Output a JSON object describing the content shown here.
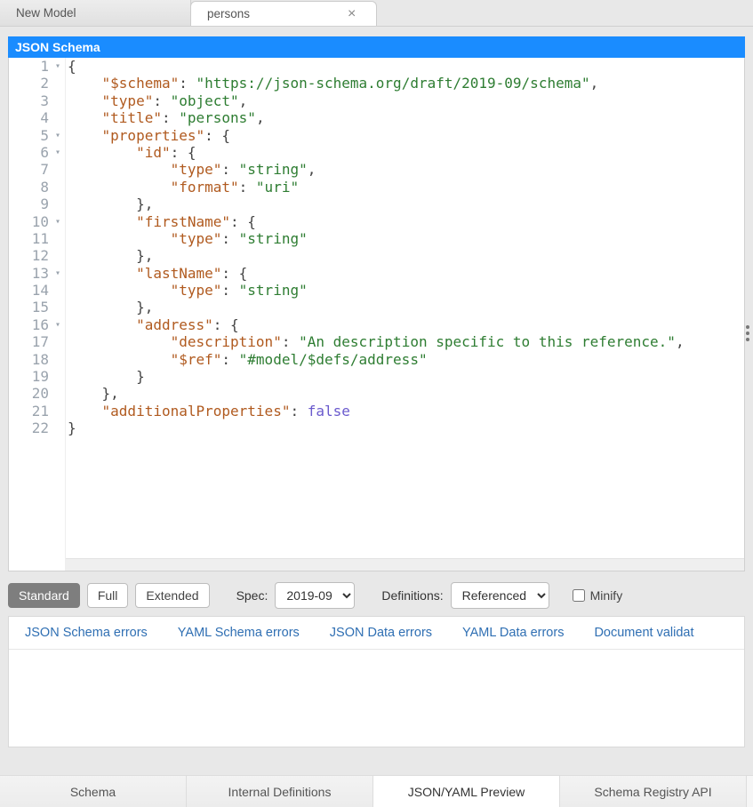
{
  "topTabs": [
    {
      "label": "New Model",
      "active": false
    },
    {
      "label": "persons",
      "active": true
    }
  ],
  "editorHeader": "JSON Schema",
  "code": {
    "lines": [
      {
        "n": 1,
        "fold": true,
        "segs": [
          {
            "t": "{",
            "c": "p"
          }
        ]
      },
      {
        "n": 2,
        "segs": [
          {
            "t": "    ",
            "c": ""
          },
          {
            "t": "\"$schema\"",
            "c": "k"
          },
          {
            "t": ": ",
            "c": "p"
          },
          {
            "t": "\"https://json-schema.org/draft/2019-09/schema\"",
            "c": "s"
          },
          {
            "t": ",",
            "c": "p"
          }
        ]
      },
      {
        "n": 3,
        "segs": [
          {
            "t": "    ",
            "c": ""
          },
          {
            "t": "\"type\"",
            "c": "k"
          },
          {
            "t": ": ",
            "c": "p"
          },
          {
            "t": "\"object\"",
            "c": "s"
          },
          {
            "t": ",",
            "c": "p"
          }
        ]
      },
      {
        "n": 4,
        "segs": [
          {
            "t": "    ",
            "c": ""
          },
          {
            "t": "\"title\"",
            "c": "k"
          },
          {
            "t": ": ",
            "c": "p"
          },
          {
            "t": "\"persons\"",
            "c": "s"
          },
          {
            "t": ",",
            "c": "p"
          }
        ]
      },
      {
        "n": 5,
        "fold": true,
        "segs": [
          {
            "t": "    ",
            "c": ""
          },
          {
            "t": "\"properties\"",
            "c": "k"
          },
          {
            "t": ": {",
            "c": "p"
          }
        ]
      },
      {
        "n": 6,
        "fold": true,
        "segs": [
          {
            "t": "        ",
            "c": ""
          },
          {
            "t": "\"id\"",
            "c": "k"
          },
          {
            "t": ": {",
            "c": "p"
          }
        ]
      },
      {
        "n": 7,
        "segs": [
          {
            "t": "            ",
            "c": ""
          },
          {
            "t": "\"type\"",
            "c": "k"
          },
          {
            "t": ": ",
            "c": "p"
          },
          {
            "t": "\"string\"",
            "c": "s"
          },
          {
            "t": ",",
            "c": "p"
          }
        ]
      },
      {
        "n": 8,
        "segs": [
          {
            "t": "            ",
            "c": ""
          },
          {
            "t": "\"format\"",
            "c": "k"
          },
          {
            "t": ": ",
            "c": "p"
          },
          {
            "t": "\"uri\"",
            "c": "s"
          }
        ]
      },
      {
        "n": 9,
        "segs": [
          {
            "t": "        },",
            "c": "p"
          }
        ]
      },
      {
        "n": 10,
        "fold": true,
        "segs": [
          {
            "t": "        ",
            "c": ""
          },
          {
            "t": "\"firstName\"",
            "c": "k"
          },
          {
            "t": ": {",
            "c": "p"
          }
        ]
      },
      {
        "n": 11,
        "segs": [
          {
            "t": "            ",
            "c": ""
          },
          {
            "t": "\"type\"",
            "c": "k"
          },
          {
            "t": ": ",
            "c": "p"
          },
          {
            "t": "\"string\"",
            "c": "s"
          }
        ]
      },
      {
        "n": 12,
        "segs": [
          {
            "t": "        },",
            "c": "p"
          }
        ]
      },
      {
        "n": 13,
        "fold": true,
        "segs": [
          {
            "t": "        ",
            "c": ""
          },
          {
            "t": "\"lastName\"",
            "c": "k"
          },
          {
            "t": ": {",
            "c": "p"
          }
        ]
      },
      {
        "n": 14,
        "segs": [
          {
            "t": "            ",
            "c": ""
          },
          {
            "t": "\"type\"",
            "c": "k"
          },
          {
            "t": ": ",
            "c": "p"
          },
          {
            "t": "\"string\"",
            "c": "s"
          }
        ]
      },
      {
        "n": 15,
        "segs": [
          {
            "t": "        },",
            "c": "p"
          }
        ]
      },
      {
        "n": 16,
        "fold": true,
        "segs": [
          {
            "t": "        ",
            "c": ""
          },
          {
            "t": "\"address\"",
            "c": "k"
          },
          {
            "t": ": {",
            "c": "p"
          }
        ]
      },
      {
        "n": 17,
        "segs": [
          {
            "t": "            ",
            "c": ""
          },
          {
            "t": "\"description\"",
            "c": "k"
          },
          {
            "t": ": ",
            "c": "p"
          },
          {
            "t": "\"An description specific to this reference.\"",
            "c": "s"
          },
          {
            "t": ",",
            "c": "p"
          }
        ]
      },
      {
        "n": 18,
        "segs": [
          {
            "t": "            ",
            "c": ""
          },
          {
            "t": "\"$ref\"",
            "c": "k"
          },
          {
            "t": ": ",
            "c": "p"
          },
          {
            "t": "\"#model/$defs/address\"",
            "c": "s"
          }
        ]
      },
      {
        "n": 19,
        "segs": [
          {
            "t": "        }",
            "c": "p"
          }
        ]
      },
      {
        "n": 20,
        "segs": [
          {
            "t": "    },",
            "c": "p"
          }
        ]
      },
      {
        "n": 21,
        "segs": [
          {
            "t": "    ",
            "c": ""
          },
          {
            "t": "\"additionalProperties\"",
            "c": "k"
          },
          {
            "t": ": ",
            "c": "p"
          },
          {
            "t": "false",
            "c": "b"
          }
        ]
      },
      {
        "n": 22,
        "segs": [
          {
            "t": "}",
            "c": "p"
          }
        ]
      }
    ]
  },
  "controls": {
    "standard": "Standard",
    "full": "Full",
    "extended": "Extended",
    "specLabel": "Spec:",
    "specValue": "2019-09",
    "defsLabel": "Definitions:",
    "defsValue": "Referenced",
    "minifyLabel": "Minify"
  },
  "errorTabs": [
    "JSON Schema errors",
    "YAML Schema errors",
    "JSON Data errors",
    "YAML Data errors",
    "Document validat"
  ],
  "bottomTabs": [
    {
      "label": "Schema",
      "active": false
    },
    {
      "label": "Internal Definitions",
      "active": false
    },
    {
      "label": "JSON/YAML Preview",
      "active": true
    },
    {
      "label": "Schema Registry API",
      "active": false
    }
  ]
}
